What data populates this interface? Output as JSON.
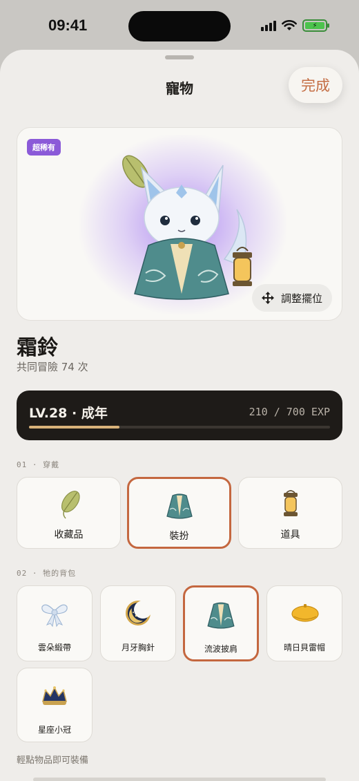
{
  "status_bar": {
    "time": "09:41",
    "icons": [
      "signal-icon",
      "wifi-icon",
      "battery-charging-icon"
    ]
  },
  "header": {
    "title": "寵物",
    "done_label": "完成"
  },
  "pet": {
    "rarity": "超稀有",
    "adjust_label": "調整擺位",
    "name": "霜鈴",
    "adventure_text": "共同冒險 74 次"
  },
  "level": {
    "label": "LV.28 · 成年",
    "exp_text": "210 / 700 EXP",
    "exp_current": 210,
    "exp_max": 700
  },
  "equip_section": {
    "label": "01 · 穿戴",
    "slots": [
      {
        "label": "收藏品",
        "icon": "leaf-icon",
        "selected": false
      },
      {
        "label": "裝扮",
        "icon": "cloak-icon",
        "selected": true
      },
      {
        "label": "道具",
        "icon": "lantern-icon",
        "selected": false
      }
    ]
  },
  "bag_section": {
    "label": "02 · 牠的背包",
    "items": [
      {
        "label": "雲朵緞帶",
        "icon": "ribbon-icon",
        "selected": false
      },
      {
        "label": "月牙胸針",
        "icon": "crescent-moon-icon",
        "selected": false
      },
      {
        "label": "流波披肩",
        "icon": "cloak-icon",
        "selected": true
      },
      {
        "label": "晴日貝雷帽",
        "icon": "beret-icon",
        "selected": false
      },
      {
        "label": "星座小冠",
        "icon": "crown-icon",
        "selected": false
      }
    ]
  },
  "hint": "輕點物品即可裝備",
  "colors": {
    "accent": "#c4673f",
    "rarity": "#8b5ad8",
    "level_bg": "#1e1b18",
    "exp_fill": "#d9b27a"
  }
}
